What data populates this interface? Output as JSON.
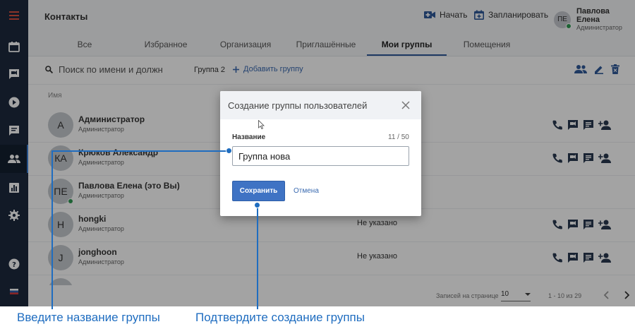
{
  "topbar": {
    "title": "Контакты",
    "start_label": "Начать",
    "schedule_label": "Запланировать",
    "user_initials": "ПЕ",
    "user_name": "Павлова Елена",
    "user_role": "Администратор"
  },
  "tabs": [
    {
      "label": "Все"
    },
    {
      "label": "Избранное"
    },
    {
      "label": "Организация"
    },
    {
      "label": "Приглашённые"
    },
    {
      "label": "Мои группы"
    },
    {
      "label": "Помещения"
    }
  ],
  "active_tab": "Мои группы",
  "toolbar": {
    "search_placeholder": "Поиск по имени и должн",
    "group_chip": "Группа 2",
    "add_group_label": "Добавить группу"
  },
  "table": {
    "column_name": "Имя",
    "rows": [
      {
        "initials": "А",
        "name": "Администратор",
        "role": "Администратор",
        "org": ""
      },
      {
        "initials": "КА",
        "name": "Крюков Александр",
        "role": "Администратор",
        "org": ""
      },
      {
        "initials": "ПЕ",
        "name": "Павлова Елена (это Вы)",
        "role": "Администратор",
        "org": ""
      },
      {
        "initials": "H",
        "name": "hongki",
        "role": "Администратор",
        "org": "Не указано"
      },
      {
        "initials": "J",
        "name": "jonghoon",
        "role": "Администратор",
        "org": "Не указано"
      }
    ]
  },
  "footer": {
    "per_page_label": "Записей на странице",
    "per_page_value": "10",
    "range": "1 - 10 из 29"
  },
  "dialog": {
    "title": "Создание группы пользователей",
    "field_label": "Название",
    "counter": "11 / 50",
    "input_value": "Группа нова",
    "save_label": "Сохранить",
    "cancel_label": "Отмена"
  },
  "annotations": {
    "enter_name": "Введите название группы",
    "confirm": "Подтвердите создание группы"
  },
  "colors": {
    "sidebar_bg": "#1d2a3e",
    "accent": "#3f73c4",
    "callout": "#1f6dc0",
    "online": "#2f9a54"
  }
}
